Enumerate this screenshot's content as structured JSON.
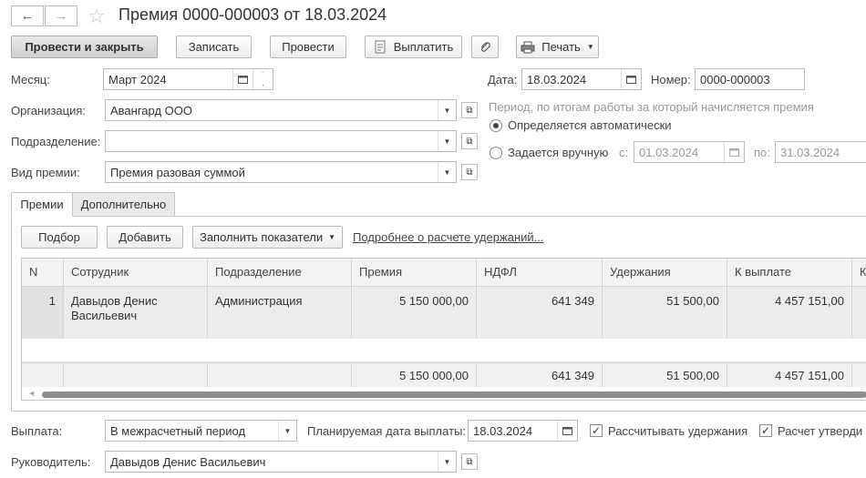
{
  "window": {
    "title": "Премия 0000-000003 от 18.03.2024"
  },
  "toolbar": {
    "post_close": "Провести и закрыть",
    "save": "Записать",
    "post": "Провести",
    "pay": "Выплатить",
    "print": "Печать"
  },
  "form": {
    "month_label": "Месяц:",
    "month_value": "Март 2024",
    "date_label": "Дата:",
    "date_value": "18.03.2024",
    "number_label": "Номер:",
    "number_value": "0000-000003",
    "org_label": "Организация:",
    "org_value": "Авангард ООО",
    "dept_label": "Подразделение:",
    "dept_value": "",
    "bonus_type_label": "Вид премии:",
    "bonus_type_value": "Премия разовая суммой",
    "period_caption": "Период, по итогам работы за который начисляется премия",
    "radio_auto": "Определяется автоматически",
    "radio_manual": "Задается вручную",
    "from_label": "с:",
    "from_value": "01.03.2024",
    "to_label": "по:",
    "to_value": "31.03.2024"
  },
  "tabs": [
    {
      "label": "Премии"
    },
    {
      "label": "Дополнительно"
    }
  ],
  "table_toolbar": {
    "pick": "Подбор",
    "add": "Добавить",
    "fill": "Заполнить показатели",
    "details_link": "Подробнее о расчете удержаний..."
  },
  "table": {
    "columns": [
      "N",
      "Сотрудник",
      "Подразделение",
      "Премия",
      "НДФЛ",
      "Удержания",
      "К выплате",
      "К"
    ],
    "rows": [
      {
        "n": "1",
        "employee": "Давыдов Денис Васильевич",
        "dept": "Администрация",
        "bonus": "5 150 000,00",
        "ndfl": "641 349",
        "deductions": "51 500,00",
        "to_pay": "4 457 151,00"
      }
    ],
    "totals": {
      "bonus": "5 150 000,00",
      "ndfl": "641 349",
      "deductions": "51 500,00",
      "to_pay": "4 457 151,00"
    }
  },
  "footer": {
    "payout_label": "Выплата:",
    "payout_value": "В межрасчетный период",
    "planned_date_label": "Планируемая дата выплаты:",
    "planned_date_value": "18.03.2024",
    "calc_deductions": "Рассчитывать удержания",
    "calc_approved": "Расчет утверди",
    "manager_label": "Руководитель:",
    "manager_value": "Давыдов Денис Васильевич"
  }
}
